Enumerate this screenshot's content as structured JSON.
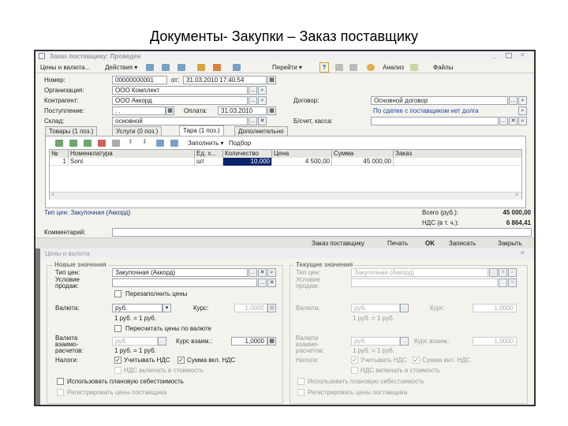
{
  "slide_title": "Документы- Закупки – Заказ поставщику",
  "window": {
    "title": "Заказ поставщику: Проведен"
  },
  "toolbar": {
    "prices": "Цены и валюта...",
    "actions": "Действия ▾",
    "goto": "Перейти ▾",
    "help": "?",
    "analysis": "Анализ",
    "files": "Файлы"
  },
  "form": {
    "number_label": "Номер:",
    "number": "00000000001",
    "from_label": "от:",
    "date": "31.03.2010 17:40:54",
    "org_label": "Организация:",
    "org": "ООО Комплект",
    "contractor_label": "Контрагент:",
    "contractor": "ООО Аккорд",
    "contract_label": "Договор:",
    "contract": "Основной договор",
    "debt_note": "По сделке с поставщиком нет долга",
    "receipt_label": "Поступление:",
    "receipt": " . .  ",
    "payment_label": "Оплата:",
    "payment": "31.03.2010",
    "account_label": "Б/счет, касса:",
    "account": "",
    "warehouse_label": "Склад:",
    "warehouse": "основной"
  },
  "tabs": [
    "Товары (1 поз.)",
    "Услуги (0 поз.)",
    "Тара (1 поз.)",
    "Дополнительно"
  ],
  "table_toolbar": {
    "fill": "Заполнить ▾",
    "select": "Подбор"
  },
  "table": {
    "headers": [
      "№",
      "Номенклатура",
      "Ед. х...",
      "Количество",
      "Цена",
      "Сумма",
      "Заказ"
    ],
    "rows": [
      [
        "1",
        "Soni",
        "шт",
        "10,000",
        "4 500,00",
        "45 000,00",
        ""
      ]
    ]
  },
  "footer": {
    "price_type": "Тип цен: Закупочная (Аккорд)",
    "total_label": "Всего (руб.):",
    "total": "45 000,00",
    "vat_label": "НДС (в т. ч.):",
    "vat": "6 864,41",
    "comment_label": "Комментарий:",
    "comment": ""
  },
  "bottom_bar": {
    "order": "Заказ поставщику",
    "print": "Печать",
    "ok": "OK",
    "save": "Записать",
    "close": "Закрыть"
  },
  "dialog": {
    "title": "Цены и валюта",
    "new": {
      "legend": "Новые значения",
      "price_type_label": "Тип цен:",
      "price_type": "Закупочная (Аккорд)",
      "sale_cond_label": "Условие продаж:",
      "sale_cond": "",
      "refill": "Перезаполнить цены",
      "currency_label": "Валюта:",
      "currency": "руб.",
      "rate_label": "Курс:",
      "rate": "1,0000",
      "rate_note": "1 руб. = 1 руб.",
      "recalc": "Пересчитать цены по валюте",
      "settle_label": "Валюта взаимо-расчетов:",
      "settle_currency": "руб.",
      "settle_rate_label": "Курс взаим.:",
      "settle_rate": "1,0000",
      "settle_note": "1 руб. = 1 руб.",
      "taxes_label": "Налоги:",
      "use_vat": "Учитывать НДС",
      "sum_incl_vat": "Сумма вкл. НДС",
      "vat_in_cost": "НДС включать в стоимость",
      "planned_cost": "Использовать плановую себестоимость",
      "register_prices": "Регистрировать цены поставщика"
    },
    "current": {
      "legend": "Текущие значения",
      "price_type_label": "Тип цен:",
      "price_type": "Закупочная (Аккорд)",
      "sale_cond_label": "Условие продаж:",
      "sale_cond": "",
      "currency_label": "Валюта:",
      "currency": "руб.",
      "rate_label": "Курс:",
      "rate": "1,0000",
      "rate_note": "1 руб. = 1 руб.",
      "settle_label": "Валюта взаимо-расчетов:",
      "settle_currency": "руб.",
      "settle_rate_label": "Курс взаим.:",
      "settle_rate": "1,0000",
      "settle_note": "1 руб. = 1 руб.",
      "taxes_label": "Налоги:",
      "use_vat": "Учитывать НДС",
      "sum_incl_vat": "Сумма вкл. НДС",
      "vat_in_cost": "НДС включать в стоимость",
      "planned_cost": "Использовать плановую себестоимость",
      "register_prices": "Регистрировать цены поставщика"
    }
  }
}
